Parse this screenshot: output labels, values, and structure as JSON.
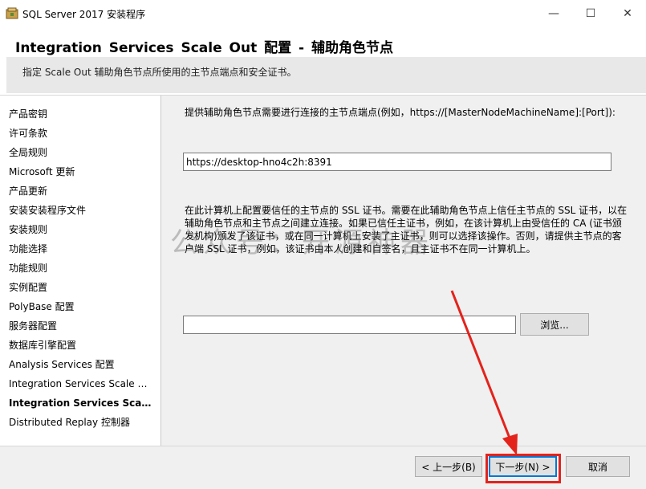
{
  "window": {
    "title": "SQL Server 2017 安装程序",
    "minimize_glyph": "—",
    "maximize_glyph": "☐",
    "close_glyph": "✕"
  },
  "banner": {
    "title": "Integration Services Scale Out 配置 - 辅助角色节点",
    "subtitle": "指定 Scale Out 辅助角色节点所使用的主节点端点和安全证书。"
  },
  "nav": {
    "items": [
      {
        "label": "产品密钥"
      },
      {
        "label": "许可条款"
      },
      {
        "label": "全局规则"
      },
      {
        "label": "Microsoft 更新"
      },
      {
        "label": "产品更新"
      },
      {
        "label": "安装安装程序文件"
      },
      {
        "label": "安装规则"
      },
      {
        "label": "功能选择"
      },
      {
        "label": "功能规则"
      },
      {
        "label": "实例配置"
      },
      {
        "label": "PolyBase 配置"
      },
      {
        "label": "服务器配置"
      },
      {
        "label": "数据库引擎配置"
      },
      {
        "label": "Analysis Services 配置"
      },
      {
        "label": "Integration Services Scale O..."
      },
      {
        "label": "Integration Services Scale ..."
      },
      {
        "label": "Distributed Replay 控制器"
      }
    ],
    "active_index": 15
  },
  "main": {
    "instruction": "提供辅助角色节点需要进行连接的主节点端点(例如，https://[MasterNodeMachineName]:[Port]):",
    "endpoint_value": "https://desktop-hno4c2h:8391",
    "ssl_description": "在此计算机上配置要信任的主节点的 SSL 证书。需要在此辅助角色节点上信任主节点的 SSL 证书，以在辅助角色节点和主节点之间建立连接。如果已信任主证书，例如，在该计算机上由受信任的 CA (证书颁发机构)颁发了该证书，或在同一计算机上安装了主证书，则可以选择该操作。否则，请提供主节点的客户端 SSL 证书，例如，该证书由本人创建和自签名，且主证书不在同一计算机上。",
    "cert_path_value": "",
    "browse_label": "浏览..."
  },
  "footer": {
    "back_label": "< 上一步(B)",
    "next_label": "下一步(N) >",
    "cancel_label": "取消"
  },
  "annotation": {
    "watermark": "公众号：开源神器",
    "highlight_color": "#e3231c"
  }
}
